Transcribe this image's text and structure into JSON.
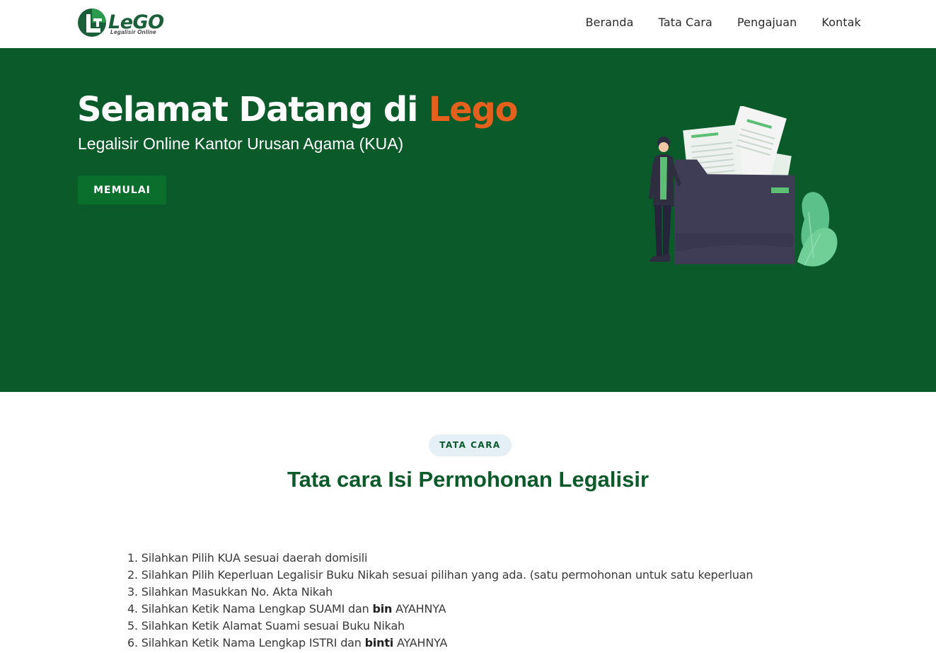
{
  "brand": {
    "name": "LeGO",
    "tagline": "Legalisir Online",
    "colors": {
      "primary": "#0b5b2a",
      "accent": "#e5601d",
      "logo": "#1b5f3a"
    }
  },
  "nav": {
    "items": [
      {
        "label": "Beranda"
      },
      {
        "label": "Tata Cara"
      },
      {
        "label": "Pengajuan"
      },
      {
        "label": "Kontak"
      }
    ]
  },
  "hero": {
    "title_prefix": "Selamat Datang di ",
    "title_accent": "Lego",
    "subtitle": "Legalisir Online Kantor Urusan Agama (KUA)",
    "cta_label": "MEMULAI",
    "illustration": "person-with-document-folder-illustration"
  },
  "tatacara": {
    "badge": "TATA CARA",
    "title": "Tata cara Isi Permohonan Legalisir",
    "steps": [
      {
        "num": "1.",
        "text": "Silahkan Pilih KUA sesuai daerah domisili"
      },
      {
        "num": "2.",
        "text": "Silahkan Pilih Keperluan Legalisir Buku Nikah sesuai pilihan yang ada. (satu permohonan untuk satu keperluan"
      },
      {
        "num": "3.",
        "text": "Silahkan Masukkan No. Akta Nikah"
      },
      {
        "num": "4.",
        "pre": "Silahkan Ketik Nama Lengkap SUAMI dan ",
        "bold": "bin",
        "post": " AYAHNYA"
      },
      {
        "num": "5.",
        "text": "Silahkan Ketik Alamat Suami sesuai Buku Nikah"
      },
      {
        "num": "6.",
        "pre": "Silahkan Ketik Nama Lengkap ISTRI dan ",
        "bold": "binti",
        "post": " AYAHNYA"
      }
    ]
  }
}
